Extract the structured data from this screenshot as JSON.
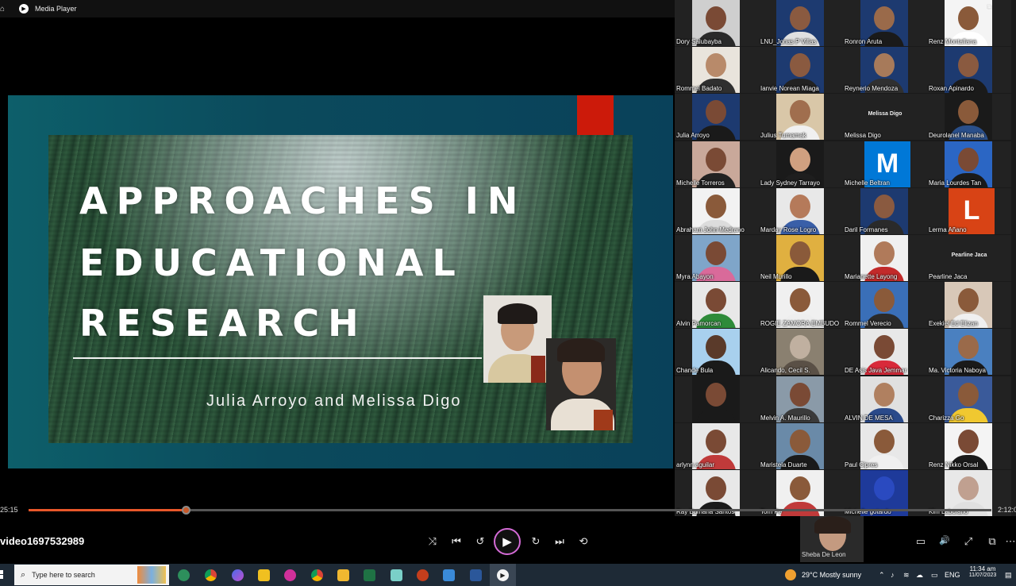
{
  "window": {
    "title": "Media Player"
  },
  "slide": {
    "title_line1": "APPROACHES IN",
    "title_line2": "EDUCATIONAL",
    "title_line3": "RESEARCH",
    "authors": "Julia Arroyo and Melissa Digo"
  },
  "gallery": {
    "participants": [
      {
        "name": "Dory Salubayba",
        "type": "video",
        "bg": "#cfcfcf",
        "skin": "#7a4a35",
        "shirt": "#2a2a2a"
      },
      {
        "name": "LNU_Jonas P Villas",
        "type": "video",
        "bg": "#1d3a70",
        "skin": "#8a5a40",
        "shirt": "#e0e0e0"
      },
      {
        "name": "Ronron Aruta",
        "type": "video",
        "bg": "#1d3a70",
        "skin": "#9a6a4a",
        "shirt": "#1a1a1a"
      },
      {
        "name": "Renz Montallana",
        "type": "video",
        "bg": "#f4f4f4",
        "skin": "#8a5a3a",
        "shirt": "#ffffff"
      },
      {
        "name": "Rommel Badato",
        "type": "video",
        "bg": "#e9e4dc",
        "skin": "#b88a6a",
        "shirt": "#2f2f2f"
      },
      {
        "name": "Ianvie Norean Miaga",
        "type": "video",
        "bg": "#1d3a70",
        "skin": "#8a5a40",
        "shirt": "#222222"
      },
      {
        "name": "Reynerio Mendoza",
        "type": "video",
        "bg": "#1d3a70",
        "skin": "#a77a5a",
        "shirt": "#303030"
      },
      {
        "name": "Roxan Apinardo",
        "type": "video",
        "bg": "#1d3a70",
        "skin": "#8a5a40",
        "shirt": "#1a1a1a"
      },
      {
        "name": "Julia Arroyo",
        "type": "video",
        "bg": "#1d3a70",
        "skin": "#7a4a35",
        "shirt": "#1a1a1a"
      },
      {
        "name": "Julius Tumamak",
        "type": "video",
        "bg": "#d9c7a8",
        "skin": "#a06e4e",
        "shirt": "#f0f0f0"
      },
      {
        "name": "Melissa Digo",
        "type": "text",
        "text": "Melissa Digo",
        "bg": "#1a1a1a"
      },
      {
        "name": "Deurolanel Manaba",
        "type": "video",
        "bg": "#1a1a1a",
        "skin": "#8a5a3a",
        "shirt": "#2a4f8a"
      },
      {
        "name": "Michelle Torreros",
        "type": "video",
        "bg": "#c9a89a",
        "skin": "#7a4a35",
        "shirt": "#222222"
      },
      {
        "name": "Lady Sydney Tarrayo",
        "type": "video",
        "bg": "#1a1a1a",
        "skin": "#d0a080",
        "shirt": "#1e1e1e"
      },
      {
        "name": "Michelle Beltran",
        "type": "letter",
        "letter": "M",
        "bg": "#0078d7"
      },
      {
        "name": "Maria Lourdes Tan",
        "type": "video",
        "bg": "#2b66c4",
        "skin": "#7a4a35",
        "shirt": "#1a1a1a"
      },
      {
        "name": "Abraham John Medrano",
        "type": "video",
        "bg": "#f2f2f2",
        "skin": "#8a5a3a",
        "shirt": "#dcdcdc"
      },
      {
        "name": "Marday Rose Logro",
        "type": "video",
        "bg": "#e8e8e8",
        "skin": "#b57a5a",
        "shirt": "#3a5fa8"
      },
      {
        "name": "Daril Formanes",
        "type": "video",
        "bg": "#1d3a70",
        "skin": "#8a5a40",
        "shirt": "#2a2a2a"
      },
      {
        "name": "Lerma Añano",
        "type": "letter",
        "letter": "L",
        "bg": "#d84315"
      },
      {
        "name": "Myra Abayon",
        "type": "video",
        "bg": "#7fa5c9",
        "skin": "#7a4a35",
        "shirt": "#d96a9a"
      },
      {
        "name": "Neil Murillo",
        "type": "video",
        "bg": "#e0b040",
        "skin": "#8a5a3a",
        "shirt": "#1a1a1a"
      },
      {
        "name": "Marianette Layong",
        "type": "video",
        "bg": "#f0f0f0",
        "skin": "#b07a5a",
        "shirt": "#c22a2a"
      },
      {
        "name": "Pearline Jaca",
        "type": "text",
        "text": "Pearline Jaca",
        "bg": "#1a1a1a"
      },
      {
        "name": "Alvin Pamorcan",
        "type": "video",
        "bg": "#e8e8e8",
        "skin": "#7a4a35",
        "shirt": "#2e8b3a"
      },
      {
        "name": "ROGIE ZAMORA EMBUDO",
        "type": "video",
        "bg": "#f0f0f0",
        "skin": "#8a5a3a",
        "shirt": "#eeeeee"
      },
      {
        "name": "Rommel Verecio",
        "type": "video",
        "bg": "#3a6fb8",
        "skin": "#8a5a3a",
        "shirt": "#2a2a2a"
      },
      {
        "name": "Exekiel Ed Elizan",
        "type": "video",
        "bg": "#d8c8b8",
        "skin": "#8a5a3a",
        "shirt": "#f0f0f0"
      },
      {
        "name": "Chande Bula",
        "type": "video",
        "bg": "#a8d0ee",
        "skin": "#5a3a2a",
        "shirt": "#1a1a1a"
      },
      {
        "name": "Alicando, Cecil S.",
        "type": "video",
        "bg": "#8a8070",
        "skin": "#c0b0a0",
        "shirt": "#5a5046"
      },
      {
        "name": "DE Asis Java Jemmar",
        "type": "video",
        "bg": "#e8e8e8",
        "skin": "#7a4a35",
        "shirt": "#d82a3a"
      },
      {
        "name": "Ma. Victoria Naboya",
        "type": "video",
        "bg": "#4a80c0",
        "skin": "#9a6a4a",
        "shirt": "#1a1a1a"
      },
      {
        "name": "",
        "type": "video",
        "bg": "#1a1a1a",
        "skin": "#7a4a35",
        "shirt": "#1a1a1a"
      },
      {
        "name": "Melvin A. Maurillo",
        "type": "video",
        "bg": "#8a9aa8",
        "skin": "#7a4a35",
        "shirt": "#3a3a3a"
      },
      {
        "name": "ALVIN DE MESA",
        "type": "video",
        "bg": "#e0e0e0",
        "skin": "#b08060",
        "shirt": "#2a4a8a"
      },
      {
        "name": "Charizza Go",
        "type": "video",
        "bg": "#3a5a9a",
        "skin": "#8a5a3a",
        "shirt": "#f0c830"
      },
      {
        "name": "arlynn aguilar",
        "type": "video",
        "bg": "#e8e8e8",
        "skin": "#7a4a35",
        "shirt": "#c03a3a"
      },
      {
        "name": "Maristela Duarte",
        "type": "video",
        "bg": "#6a8aa8",
        "skin": "#8a5a3a",
        "shirt": "#1a1a1a"
      },
      {
        "name": "Paul Cipres",
        "type": "video",
        "bg": "#e8e8e8",
        "skin": "#8a5a3a",
        "shirt": "#f0f0f0"
      },
      {
        "name": "Renz Nikko Orsal",
        "type": "video",
        "bg": "#f4f4f4",
        "skin": "#7a4a35",
        "shirt": "#1a1a1a"
      },
      {
        "name": "Ray Bumana Santos",
        "type": "video",
        "bg": "#e8e8e8",
        "skin": "#7a4a35",
        "shirt": "#1a1a1a"
      },
      {
        "name": "Tom Pe",
        "type": "video",
        "bg": "#f0f0f0",
        "skin": "#8a5a3a",
        "shirt": "#c03a3a"
      },
      {
        "name": "Michelle gotardo",
        "type": "video",
        "bg": "#1e3a9a",
        "skin": "#2a4ac0",
        "shirt": "#1e3a9a"
      },
      {
        "name": "Kim Labcrano",
        "type": "video",
        "bg": "#e8e8e8",
        "skin": "#c0a090",
        "shirt": "#e0e0e0"
      }
    ],
    "floating_tile": "Sheba De Leon"
  },
  "player": {
    "elapsed": "25:15",
    "total": "2:12:0",
    "progress": 0.163,
    "file_name": "video1697532989",
    "buttons": {
      "shuffle": "⤨",
      "previous": "⏮",
      "rewind": "↺",
      "play": "▶",
      "forward": "↻",
      "next": "⏭",
      "repeat": "⟲",
      "miniplayer": "▭",
      "volume": "🔊",
      "fullscreen": "⤢",
      "cast": "⧉",
      "more": "⋯"
    }
  },
  "taskbar": {
    "search_placeholder": "Type here to search",
    "weather": "29°C  Mostly sunny",
    "language": "ENG",
    "time": "11:34 am",
    "date": "11/07/2023"
  },
  "colors": {
    "accent": "#e8572a",
    "play_ring": "#d46bd6",
    "slide_red": "#cc1a0a",
    "taskbar": "#1e2a36"
  }
}
